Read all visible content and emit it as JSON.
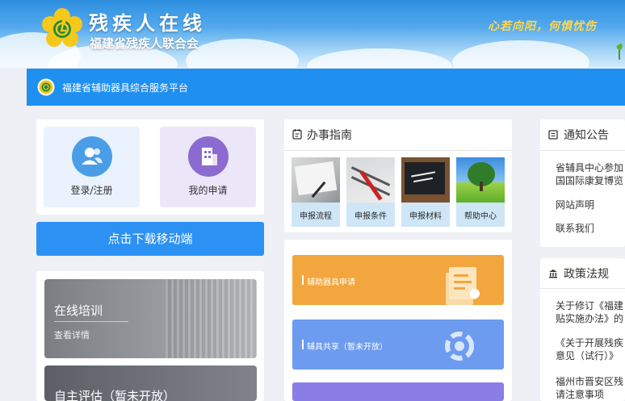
{
  "header": {
    "site_title": "残疾人在线",
    "site_subtitle": "福建省残疾人联合会",
    "slogan": "心若向阳，何惧忧伤"
  },
  "platform_bar": {
    "name": "福建省辅助器具综合服务平台"
  },
  "left": {
    "tiles": [
      {
        "label": "登录/注册",
        "icon": "user-group-icon",
        "color": "#4a9ee8"
      },
      {
        "label": "我的申请",
        "icon": "building-icon",
        "color": "#8b6bd0"
      }
    ],
    "download_label": "点击下载移动端",
    "cards": [
      {
        "title": "在线培训",
        "sub": "查看详情"
      },
      {
        "title": "自主评估（暂未开放）"
      }
    ]
  },
  "guide": {
    "title": "办事指南",
    "items": [
      {
        "label": "申报流程",
        "image": "document-signing-photo"
      },
      {
        "label": "申报条件",
        "image": "checklist-photo"
      },
      {
        "label": "申报材料",
        "image": "thanks-chalkboard-photo"
      },
      {
        "label": "帮助中心",
        "image": "tree-landscape-photo"
      }
    ]
  },
  "services": [
    {
      "label": "辅助器具申请",
      "color": "#f3a63d"
    },
    {
      "label": "辅具共享（暂未开放）",
      "color": "#6d9bef"
    },
    {
      "label": "",
      "color": "#8a7de6"
    }
  ],
  "notices": {
    "title": "通知公告",
    "items": [
      {
        "line1": "省辅具中心参加",
        "line2": "国国际康复博览"
      },
      {
        "line1": "网站声明"
      },
      {
        "line1": "联系我们"
      }
    ]
  },
  "policies": {
    "title": "政策法规",
    "items": [
      {
        "line1": "关于修订《福建",
        "line2": "贴实施办法》的"
      },
      {
        "line1": "《关于开展残疾",
        "line2": "意见（试行）》"
      },
      {
        "line1": "福州市晋安区残",
        "line2": "请注意事项"
      }
    ]
  }
}
